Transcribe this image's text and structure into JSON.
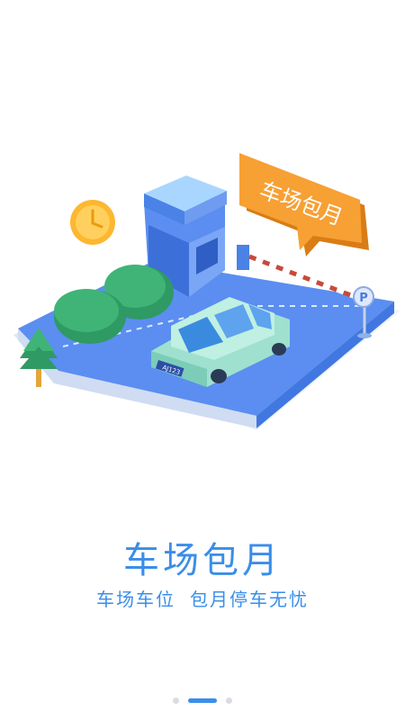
{
  "illustration": {
    "sign_text": "车场包月",
    "plate_text": "AJ123",
    "parking_icon": "P"
  },
  "content": {
    "title": "车场包月",
    "subtitle_left": "车场车位",
    "subtitle_right": "包月停车无忧"
  },
  "pager": {
    "total_pages": 3,
    "active_index": 1
  },
  "colors": {
    "accent": "#3a8ee8",
    "sign_orange": "#f7a034",
    "ground_blue": "#5b8ef0",
    "car_mint": "#bff0e2"
  }
}
